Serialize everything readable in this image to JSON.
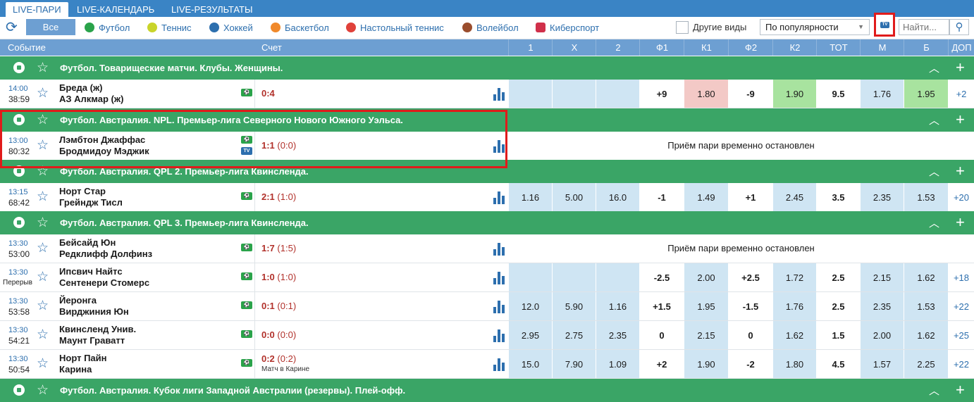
{
  "tabs": [
    "LIVE-ПАРИ",
    "LIVE-КАЛЕНДАРЬ",
    "LIVE-РЕЗУЛЬТАТЫ"
  ],
  "filter": {
    "all_label": "Все",
    "sports": [
      {
        "label": "Футбол",
        "icon": "football-icon",
        "color": "#2aa34a"
      },
      {
        "label": "Теннис",
        "icon": "tennis-icon",
        "color": "#c9d42a"
      },
      {
        "label": "Хоккей",
        "icon": "hockey-icon",
        "color": "#2d6fae"
      },
      {
        "label": "Баскетбол",
        "icon": "basketball-icon",
        "color": "#f0892b"
      },
      {
        "label": "Настольный теннис",
        "icon": "table-tennis-icon",
        "color": "#e0413a"
      },
      {
        "label": "Волейбол",
        "icon": "volleyball-icon",
        "color": "#9a4d2d"
      },
      {
        "label": "Киберспорт",
        "icon": "esports-icon",
        "color": "#d0304a"
      }
    ],
    "other_label": "Другие виды",
    "sort_value": "По популярности",
    "search_placeholder": "Найти..."
  },
  "header": {
    "event": "Событие",
    "score": "Счет",
    "odds": [
      "1",
      "X",
      "2",
      "Ф1",
      "К1",
      "Ф2",
      "К2",
      "ТОТ",
      "М",
      "Б",
      "ДОП"
    ]
  },
  "suspended_text": "Приём пари временно остановлен",
  "leagues": [
    "Футбол. Товарищеские матчи. Клубы. Женщины.",
    "Футбол. Австралия. NPL. Премьер-лига Северного Нового Южного Уэльса.",
    "Футбол. Австралия. QPL 2. Премьер-лига Квинсленда.",
    "Футбол. Австралия. QPL 3. Премьер-лига Квинсленда.",
    "Футбол. Австралия. Кубок лиги Западной Австралии (резервы). Плей-офф."
  ],
  "events": [
    {
      "time": "14:00",
      "clock": "38:59",
      "home": "Бреда (ж)",
      "away": "АЗ Алкмар (ж)",
      "score": "0:4",
      "half": "",
      "note": "",
      "odds": [
        "",
        "",
        "",
        "+9",
        "1.80",
        "-9",
        "1.90",
        "9.5",
        "1.76",
        "1.95",
        "+2"
      ]
    },
    {
      "time": "13:00",
      "clock": "80:32",
      "home": "Лэмбтон Джаффас",
      "away": "Бродмидоу Мэджик",
      "score": "1:1",
      "half": "(0:0)",
      "note": ""
    },
    {
      "time": "13:15",
      "clock": "68:42",
      "home": "Норт Стар",
      "away": "Грейндж Тисл",
      "score": "2:1",
      "half": "(1:0)",
      "note": "",
      "odds": [
        "1.16",
        "5.00",
        "16.0",
        "-1",
        "1.49",
        "+1",
        "2.45",
        "3.5",
        "2.35",
        "1.53",
        "+20"
      ]
    },
    {
      "time": "13:30",
      "clock": "53:00",
      "home": "Бейсайд Юн",
      "away": "Редклифф Долфинз",
      "score": "1:7",
      "half": "(1:5)",
      "note": ""
    },
    {
      "time": "13:30",
      "clock": "Перерыв",
      "home": "Ипсвич Найтс",
      "away": "Сентенери Стомерс",
      "score": "1:0",
      "half": "(1:0)",
      "note": "",
      "odds": [
        "",
        "",
        "",
        "-2.5",
        "2.00",
        "+2.5",
        "1.72",
        "2.5",
        "2.15",
        "1.62",
        "+18"
      ]
    },
    {
      "time": "13:30",
      "clock": "53:58",
      "home": "Йеронга",
      "away": "Вирджиния Юн",
      "score": "0:1",
      "half": "(0:1)",
      "note": "",
      "odds": [
        "12.0",
        "5.90",
        "1.16",
        "+1.5",
        "1.95",
        "-1.5",
        "1.76",
        "2.5",
        "2.35",
        "1.53",
        "+22"
      ]
    },
    {
      "time": "13:30",
      "clock": "54:21",
      "home": "Квинсленд Унив.",
      "away": "Маунт Граватт",
      "score": "0:0",
      "half": "(0:0)",
      "note": "",
      "odds": [
        "2.95",
        "2.75",
        "2.35",
        "0",
        "2.15",
        "0",
        "1.62",
        "1.5",
        "2.00",
        "1.62",
        "+25"
      ]
    },
    {
      "time": "13:30",
      "clock": "50:54",
      "home": "Норт Пайн",
      "away": "Карина",
      "score": "0:2",
      "half": "(0:2)",
      "note": "Матч в Карине",
      "odds": [
        "15.0",
        "7.90",
        "1.09",
        "+2",
        "1.90",
        "-2",
        "1.80",
        "4.5",
        "1.57",
        "2.25",
        "+22"
      ]
    }
  ],
  "colors": {
    "accent": "#3a84c5",
    "header": "#6d9fd2",
    "league": "#3aa566",
    "score": "#b1302a",
    "highlight": "#e01b1b"
  }
}
